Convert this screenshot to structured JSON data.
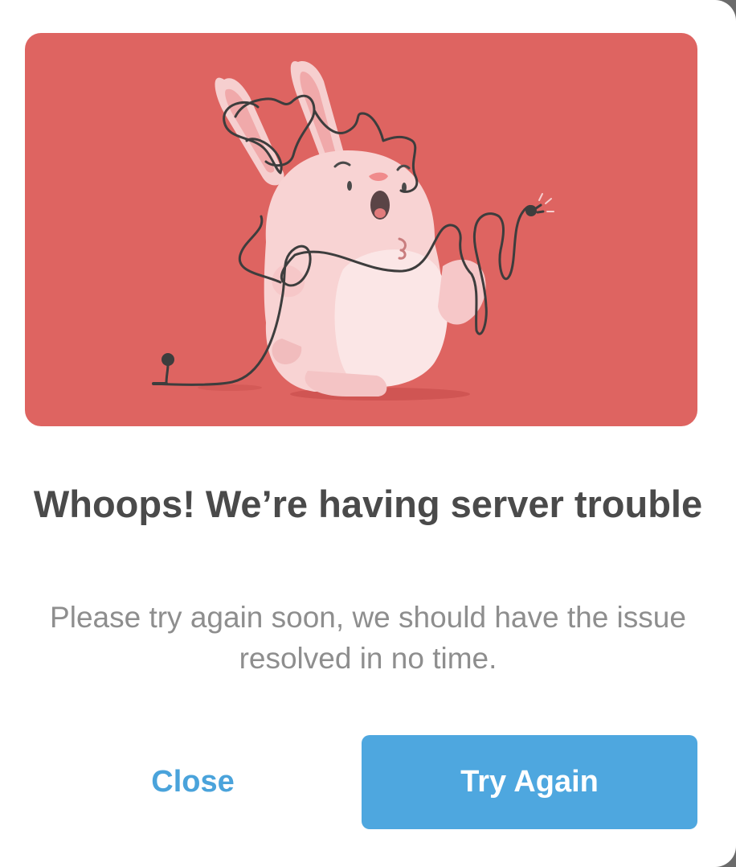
{
  "dialog": {
    "illustration_icon": "unplugged-bunny-illustration",
    "title": "Whoops! We’re having server trouble",
    "message": "Please try again soon, we should have the issue resolved in no time.",
    "close_label": "Close",
    "try_again_label": "Try Again"
  },
  "colors": {
    "hero_background": "#de6461",
    "primary_button": "#4ea7df",
    "link_text": "#4aa3db",
    "title_text": "#4a4a4a",
    "body_text": "#8e8e8e"
  }
}
